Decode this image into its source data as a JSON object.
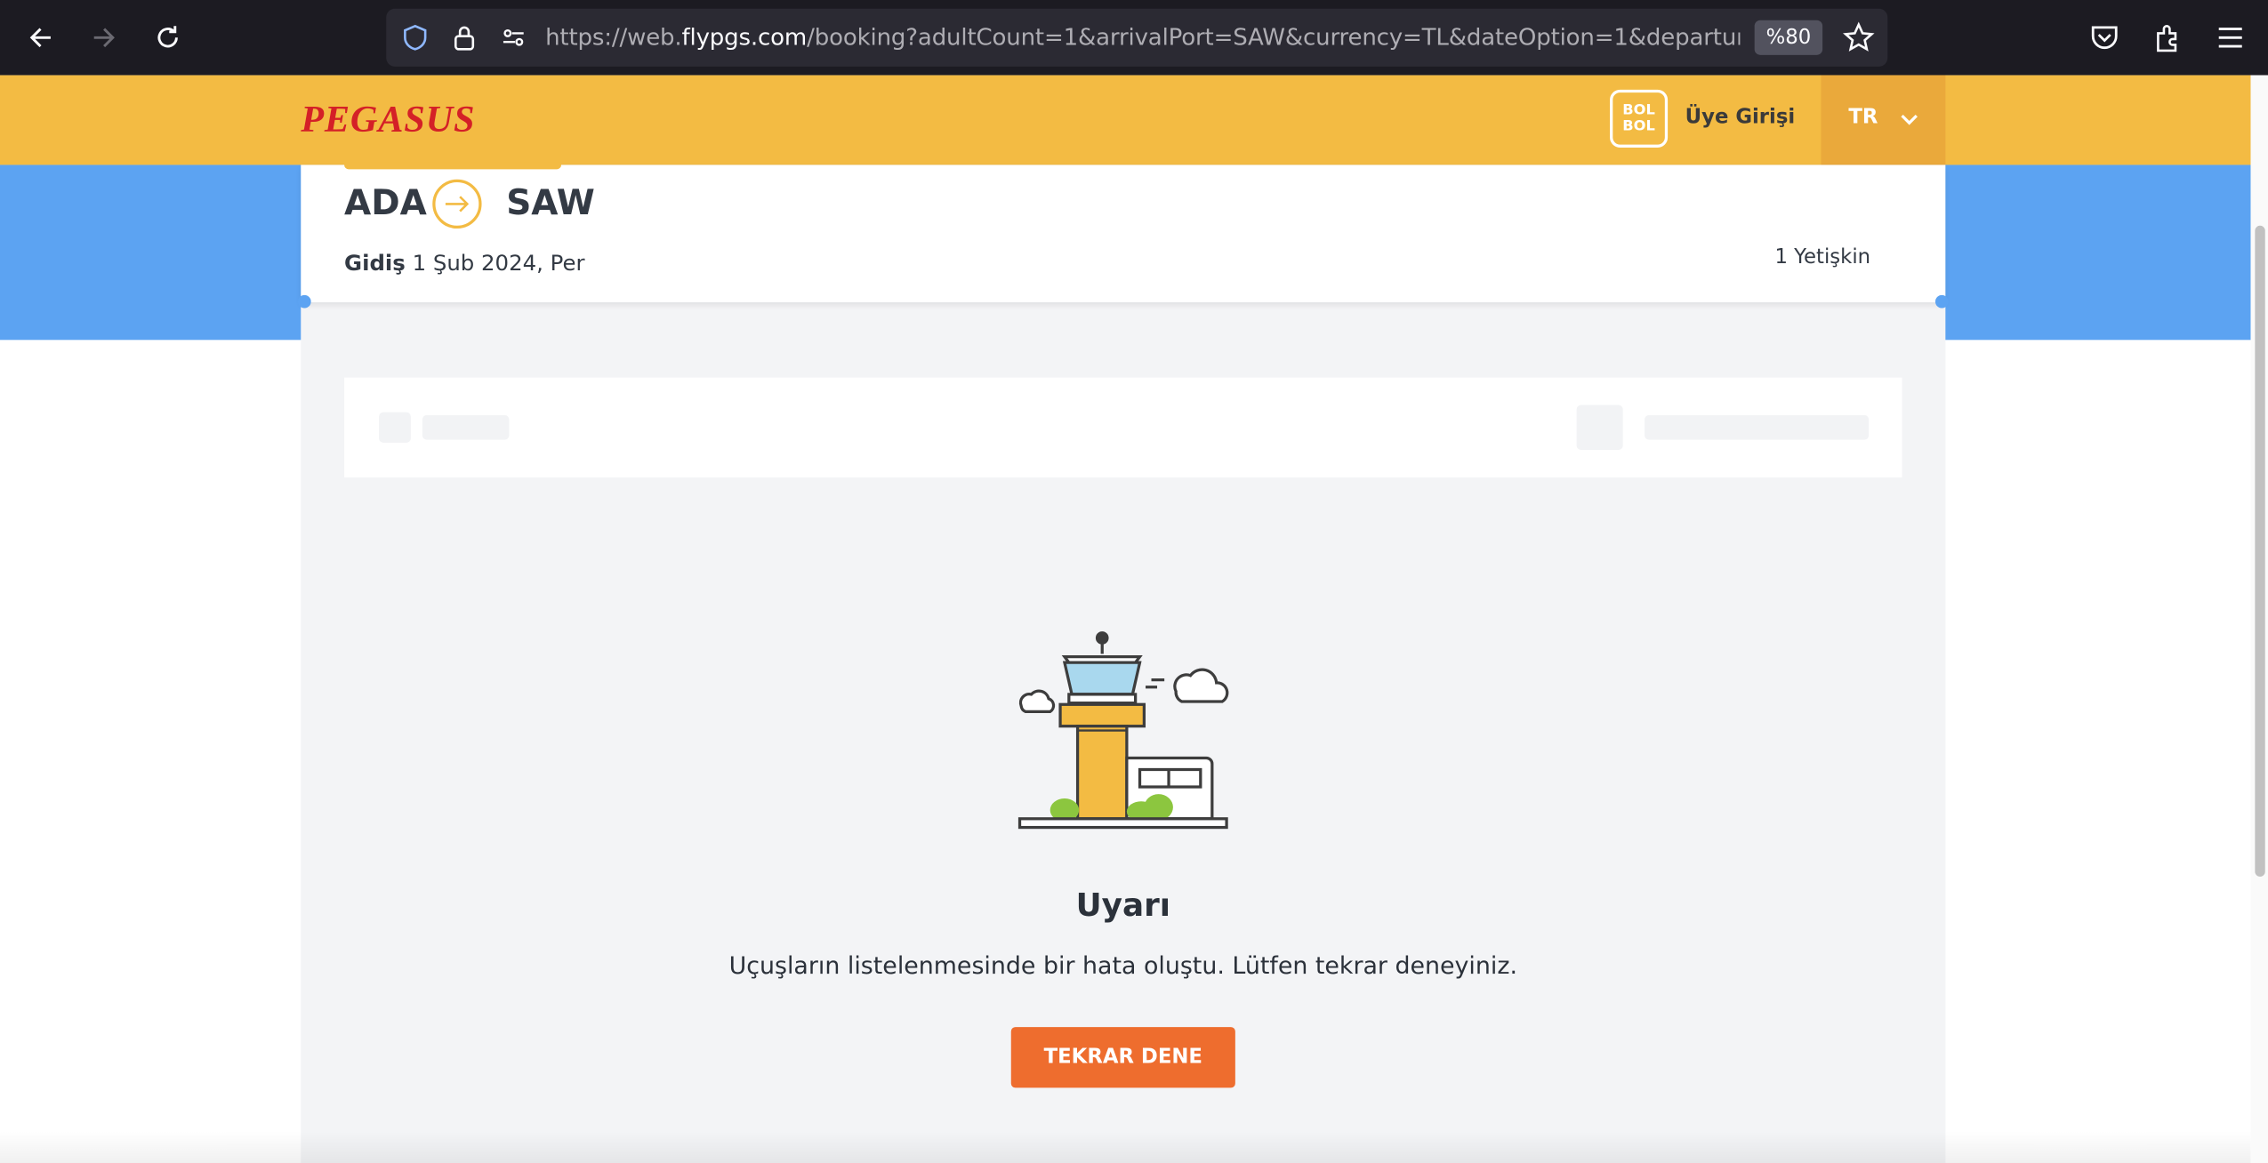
{
  "browser": {
    "url_prefix": "https://web.",
    "url_domain": "flypgs.com",
    "url_path": "/booking?adultCount=1&arrivalPort=SAW&currency=TL&dateOption=1&departureD",
    "zoom": "%80"
  },
  "header": {
    "logo": "PEGASUS",
    "bolbol_line1": "BOL",
    "bolbol_line2": "BOL",
    "login": "Üye Girişi",
    "language": "TR"
  },
  "route": {
    "origin": "ADA",
    "destination": "SAW",
    "direction_label": "Gidiş",
    "date": "1 Şub 2024, Per",
    "passengers": "1 Yetişkin"
  },
  "error": {
    "title": "Uyarı",
    "message": "Uçuşların listelenmesinde bir hata oluştu. Lütfen tekrar deneyiniz.",
    "retry_label": "TEKRAR DENE"
  },
  "colors": {
    "header": "#f3bb43",
    "band": "#5ca3f2",
    "button": "#ee6d2e"
  }
}
